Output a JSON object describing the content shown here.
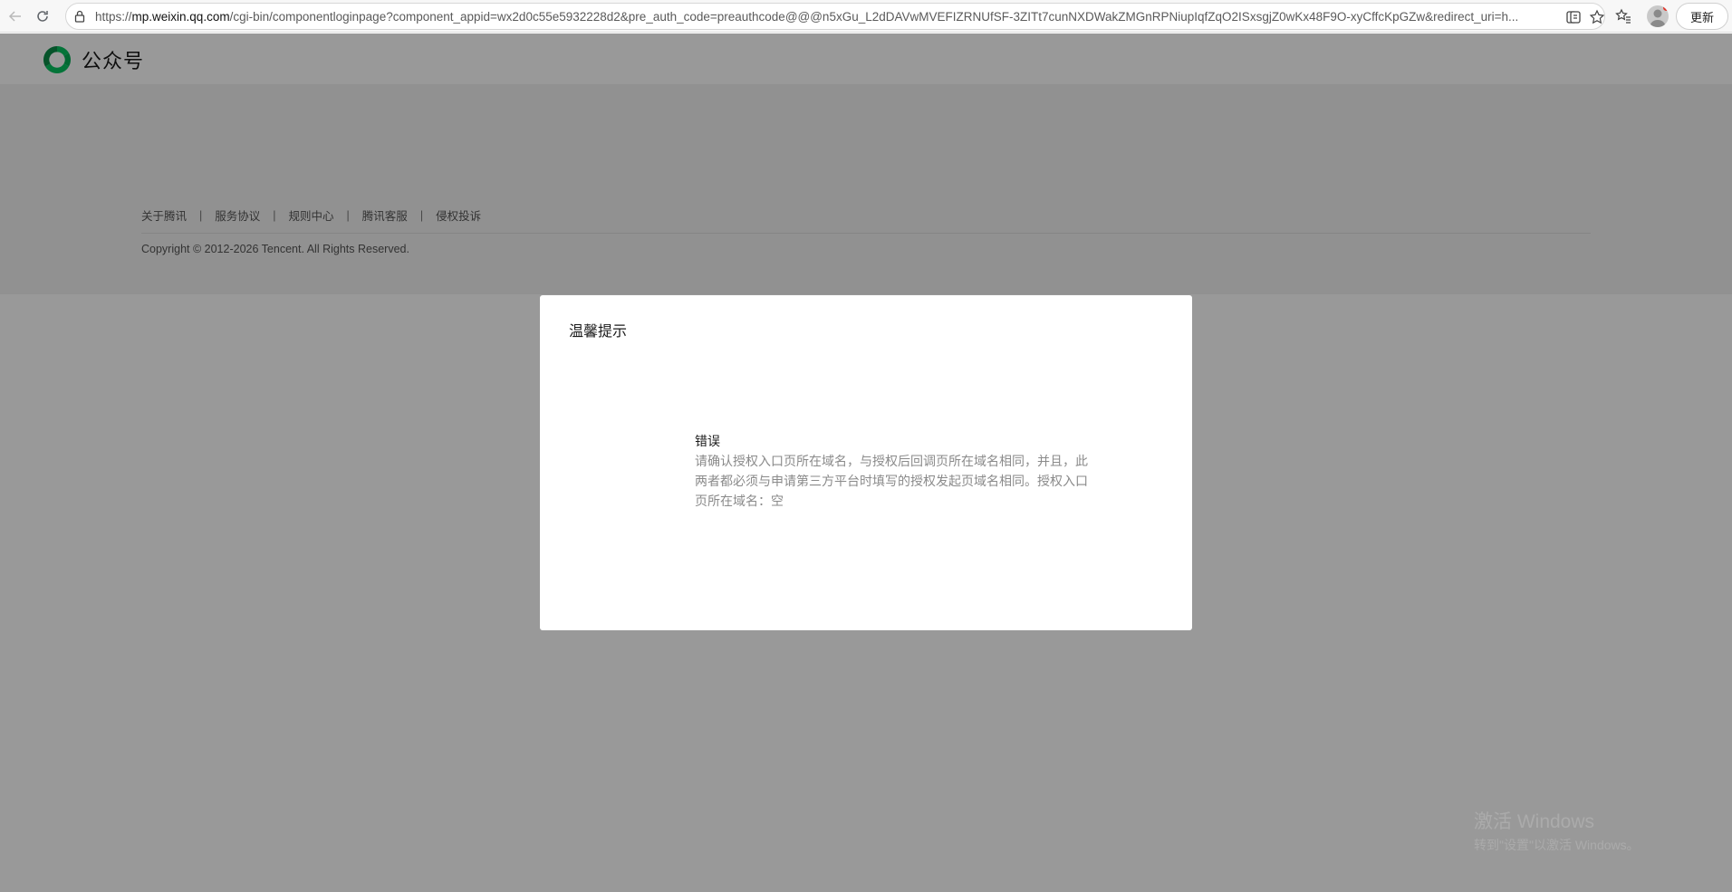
{
  "browser": {
    "url_prefix": "https://",
    "url_domain": "mp.weixin.qq.com",
    "url_rest": "/cgi-bin/componentloginpage?component_appid=wx2d0c55e5932228d2&pre_auth_code=preauthcode@@@n5xGu_L2dDAVwMVEFIZRNUfSF-3ZITt7cunNXDWakZMGnRPNiupIqfZqO2ISxsgjZ0wKx48F9O-xyCffcKpGZw&redirect_uri=h...",
    "update_label": "更新"
  },
  "header": {
    "logo_text": "公众号"
  },
  "footer": {
    "links": [
      "关于腾讯",
      "服务协议",
      "规则中心",
      "腾讯客服",
      "侵权投诉"
    ],
    "copyright": "Copyright © 2012-2026 Tencent. All Rights Reserved."
  },
  "dialog": {
    "title": "温馨提示",
    "error_title": "错误",
    "error_message": "请确认授权入口页所在域名，与授权后回调页所在域名相同，并且，此两者都必须与申请第三方平台时填写的授权发起页域名相同。授权入口页所在域名：空"
  },
  "watermark": {
    "line1": "激活 Windows",
    "line2": "转到\"设置\"以激活 Windows。"
  },
  "colors": {
    "overlay": "#000000",
    "brand_green": "#07c160",
    "dialog_bg": "#ffffff"
  }
}
